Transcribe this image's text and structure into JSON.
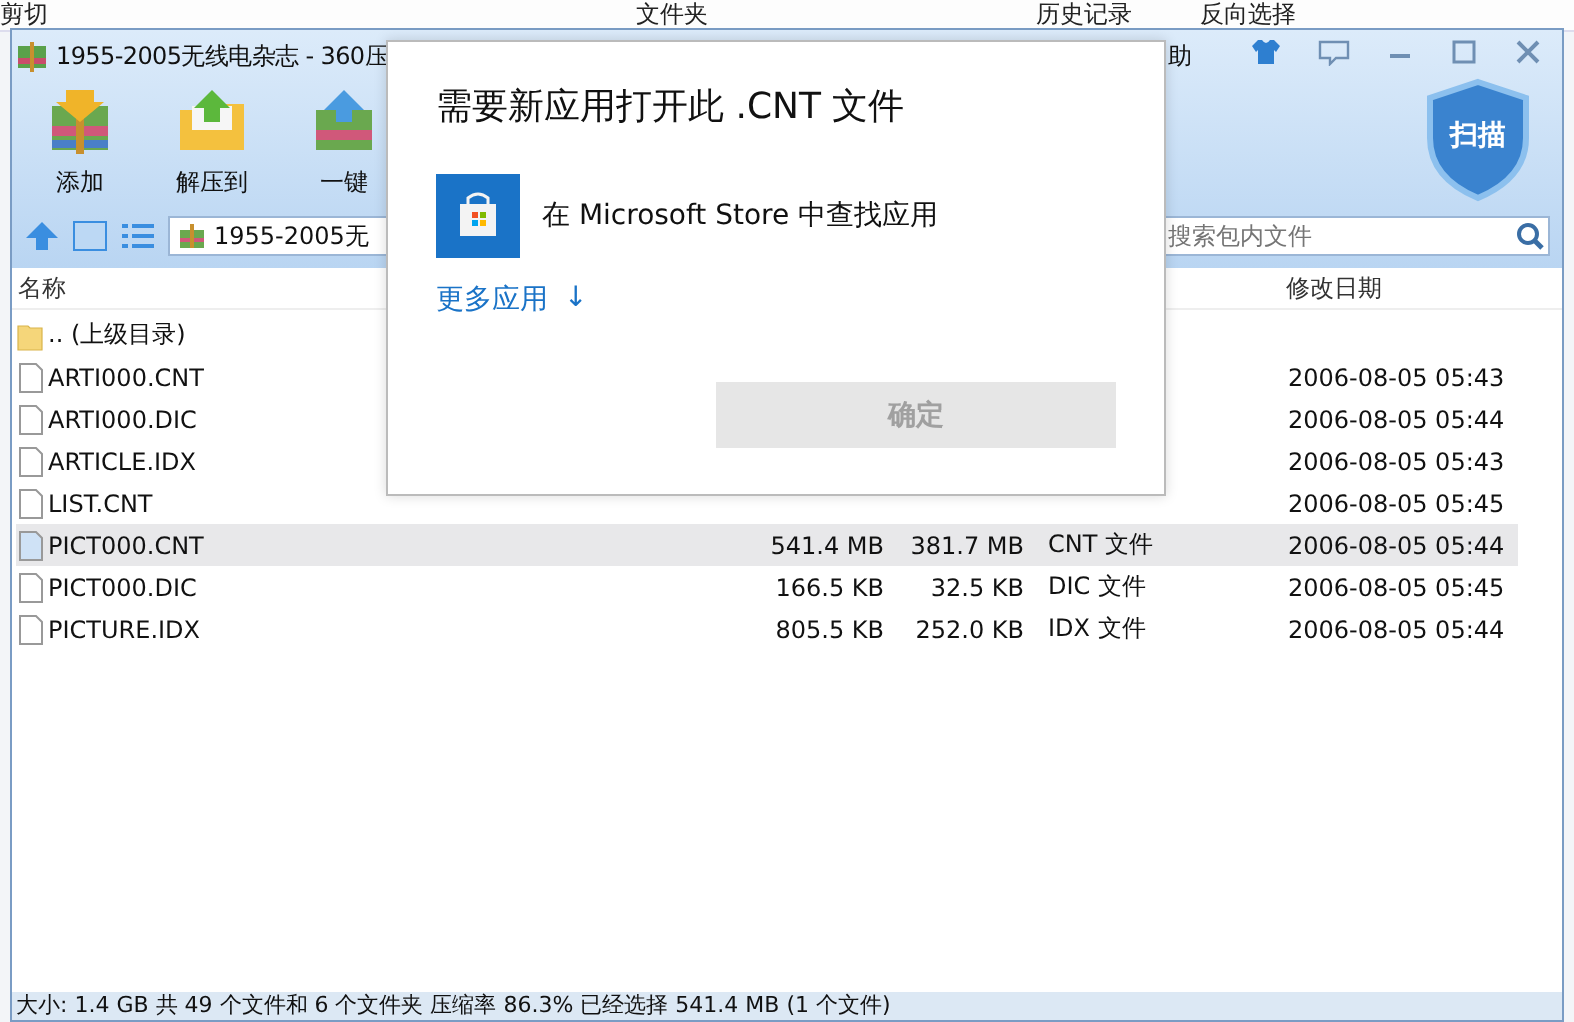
{
  "background_ribbon": {
    "items": [
      {
        "label": "剪切"
      },
      {
        "label": "文件夹"
      },
      {
        "label": "历史记录"
      },
      {
        "label": "反向选择"
      }
    ]
  },
  "archive_window": {
    "title": "1955-2005无线电杂志 - 360压",
    "help_menu": "助",
    "toolbar": [
      {
        "label": "添加",
        "kind": "add"
      },
      {
        "label": "解压到",
        "kind": "extract"
      },
      {
        "label": "一键",
        "kind": "oneclick"
      }
    ],
    "scan_button": "扫描",
    "address": "1955-2005无",
    "search": {
      "placeholder": "搜索包内文件"
    },
    "columns": {
      "column_1": "名称",
      "column_5": "修改日期"
    },
    "rows": [
      {
        "kind": "folder",
        "name": ".. (上级目录)",
        "size": "",
        "packed": "",
        "type": "",
        "date": "",
        "selected": false
      },
      {
        "kind": "file",
        "name": "ARTI000.CNT",
        "size": "",
        "packed": "",
        "type": "",
        "date": "2006-08-05 05:43",
        "selected": false
      },
      {
        "kind": "file",
        "name": "ARTI000.DIC",
        "size": "",
        "packed": "",
        "type": "",
        "date": "2006-08-05 05:44",
        "selected": false
      },
      {
        "kind": "file",
        "name": "ARTICLE.IDX",
        "size": "",
        "packed": "",
        "type": "",
        "date": "2006-08-05 05:43",
        "selected": false
      },
      {
        "kind": "file",
        "name": "LIST.CNT",
        "size": "",
        "packed": "",
        "type": "",
        "date": "2006-08-05 05:45",
        "selected": false
      },
      {
        "kind": "file",
        "name": "PICT000.CNT",
        "size": "541.4 MB",
        "packed": "381.7 MB",
        "type": "CNT 文件",
        "date": "2006-08-05 05:44",
        "selected": true
      },
      {
        "kind": "file",
        "name": "PICT000.DIC",
        "size": "166.5 KB",
        "packed": "32.5 KB",
        "type": "DIC 文件",
        "date": "2006-08-05 05:45",
        "selected": false
      },
      {
        "kind": "file",
        "name": "PICTURE.IDX",
        "size": "805.5 KB",
        "packed": "252.0 KB",
        "type": "IDX 文件",
        "date": "2006-08-05 05:44",
        "selected": false
      }
    ],
    "status_bar": "大小: 1.4 GB 共 49 个文件和 6 个文件夹 压缩率 86.3% 已经选择 541.4 MB (1 个文件)"
  },
  "dialog": {
    "title": "需要新应用打开此 .CNT 文件",
    "store_option": "在 Microsoft Store 中查找应用",
    "more_apps": "更多应用",
    "more_arrow": "↓",
    "ok_button": {
      "label": "确定",
      "disabled": true
    }
  }
}
